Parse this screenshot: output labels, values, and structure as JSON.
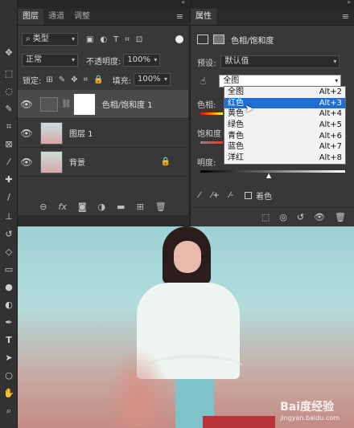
{
  "layers_panel": {
    "tabs": [
      "图层",
      "通道",
      "调整"
    ],
    "filter_kind": "类型",
    "blend_mode": "正常",
    "opacity_label": "不透明度:",
    "opacity_value": "100%",
    "lock_label": "锁定:",
    "fill_label": "填充:",
    "fill_value": "100%",
    "layers": [
      {
        "name": "色相/饱和度 1"
      },
      {
        "name": "图层 1"
      },
      {
        "name": "背景"
      }
    ]
  },
  "properties_panel": {
    "tab": "属性",
    "title": "色相/饱和度",
    "preset_label": "预设:",
    "preset_value": "默认值",
    "channel_value": "全图",
    "hue_label": "色相:",
    "saturation_label": "饱和度",
    "lightness_label": "明度:",
    "colorize_label": "着色",
    "channel_options": [
      {
        "label": "全图",
        "shortcut": "Alt+2"
      },
      {
        "label": "红色",
        "shortcut": "Alt+3"
      },
      {
        "label": "黄色",
        "shortcut": "Alt+4"
      },
      {
        "label": "绿色",
        "shortcut": "Alt+5"
      },
      {
        "label": "青色",
        "shortcut": "Alt+6"
      },
      {
        "label": "蓝色",
        "shortcut": "Alt+7"
      },
      {
        "label": "洋红",
        "shortcut": "Alt+8"
      }
    ],
    "selected_option_index": 1
  },
  "watermark": {
    "brand": "Bai度经验",
    "url": "jingyan.baidu.com"
  },
  "colors": {
    "selection": "#1e6ed6",
    "panel": "#383838",
    "dark": "#2a2a2a"
  }
}
